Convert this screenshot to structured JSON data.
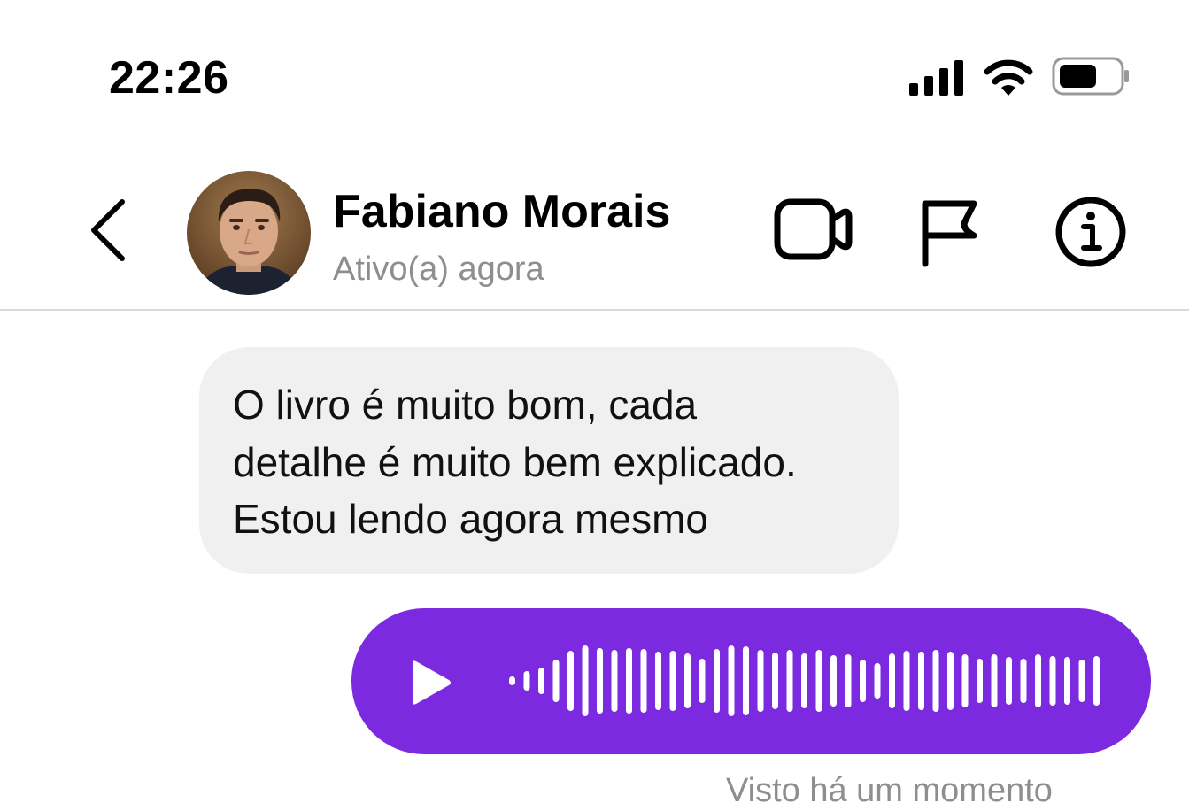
{
  "status_bar": {
    "time": "22:26",
    "icons": [
      "cellular-signal-icon",
      "wifi-icon",
      "battery-icon"
    ]
  },
  "header": {
    "back_icon": "chevron-left-icon",
    "contact_name": "Fabiano Morais",
    "contact_status": "Ativo(a) agora",
    "actions": [
      "video-call-icon",
      "report-flag-icon",
      "info-icon"
    ]
  },
  "messages": [
    {
      "direction": "incoming",
      "type": "text",
      "lines": [
        "O livro é muito bom, cada",
        "detalhe é muito bem explicado.",
        "Estou lendo agora mesmo"
      ]
    },
    {
      "direction": "outgoing",
      "type": "voice",
      "play_icon": "play-icon"
    }
  ],
  "seen_status": "Visto há um momento",
  "colors": {
    "accent": "#7c2ae0",
    "incoming_bubble": "#f0f0f0",
    "secondary_text": "#8e8e8e",
    "divider": "#d9d9d9"
  }
}
